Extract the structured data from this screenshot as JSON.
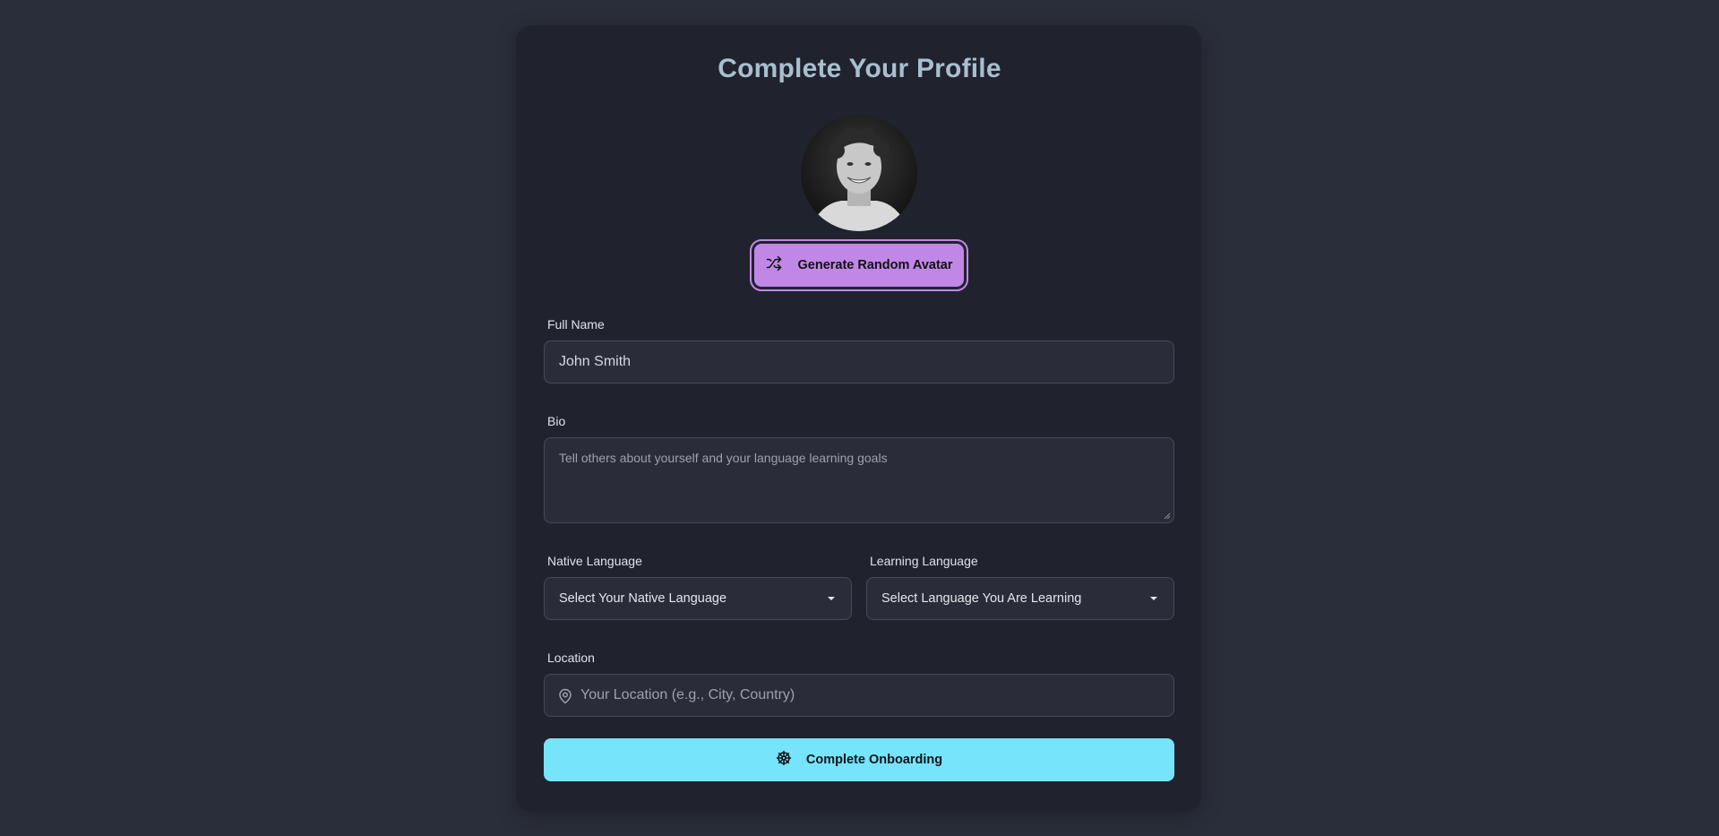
{
  "page": {
    "title": "Complete Your Profile"
  },
  "avatar": {
    "generate_button_label": "Generate Random Avatar",
    "generate_icon": "shuffle-icon"
  },
  "form": {
    "full_name": {
      "label": "Full Name",
      "value": "John Smith"
    },
    "bio": {
      "label": "Bio",
      "placeholder": "Tell others about yourself and your language learning goals"
    },
    "native_language": {
      "label": "Native Language",
      "selected": "Select Your Native Language"
    },
    "learning_language": {
      "label": "Learning Language",
      "selected": "Select Language You Are Learning"
    },
    "location": {
      "label": "Location",
      "placeholder": "Your Location (e.g., City, Country)",
      "icon": "map-pin-icon"
    },
    "submit": {
      "label": "Complete Onboarding",
      "icon": "ship-wheel-icon"
    }
  },
  "colors": {
    "background": "#2a2e3a",
    "card": "#20232d",
    "accent_secondary": "#c187e7",
    "accent_primary": "#76e4fb",
    "title": "#a9bfcf"
  }
}
